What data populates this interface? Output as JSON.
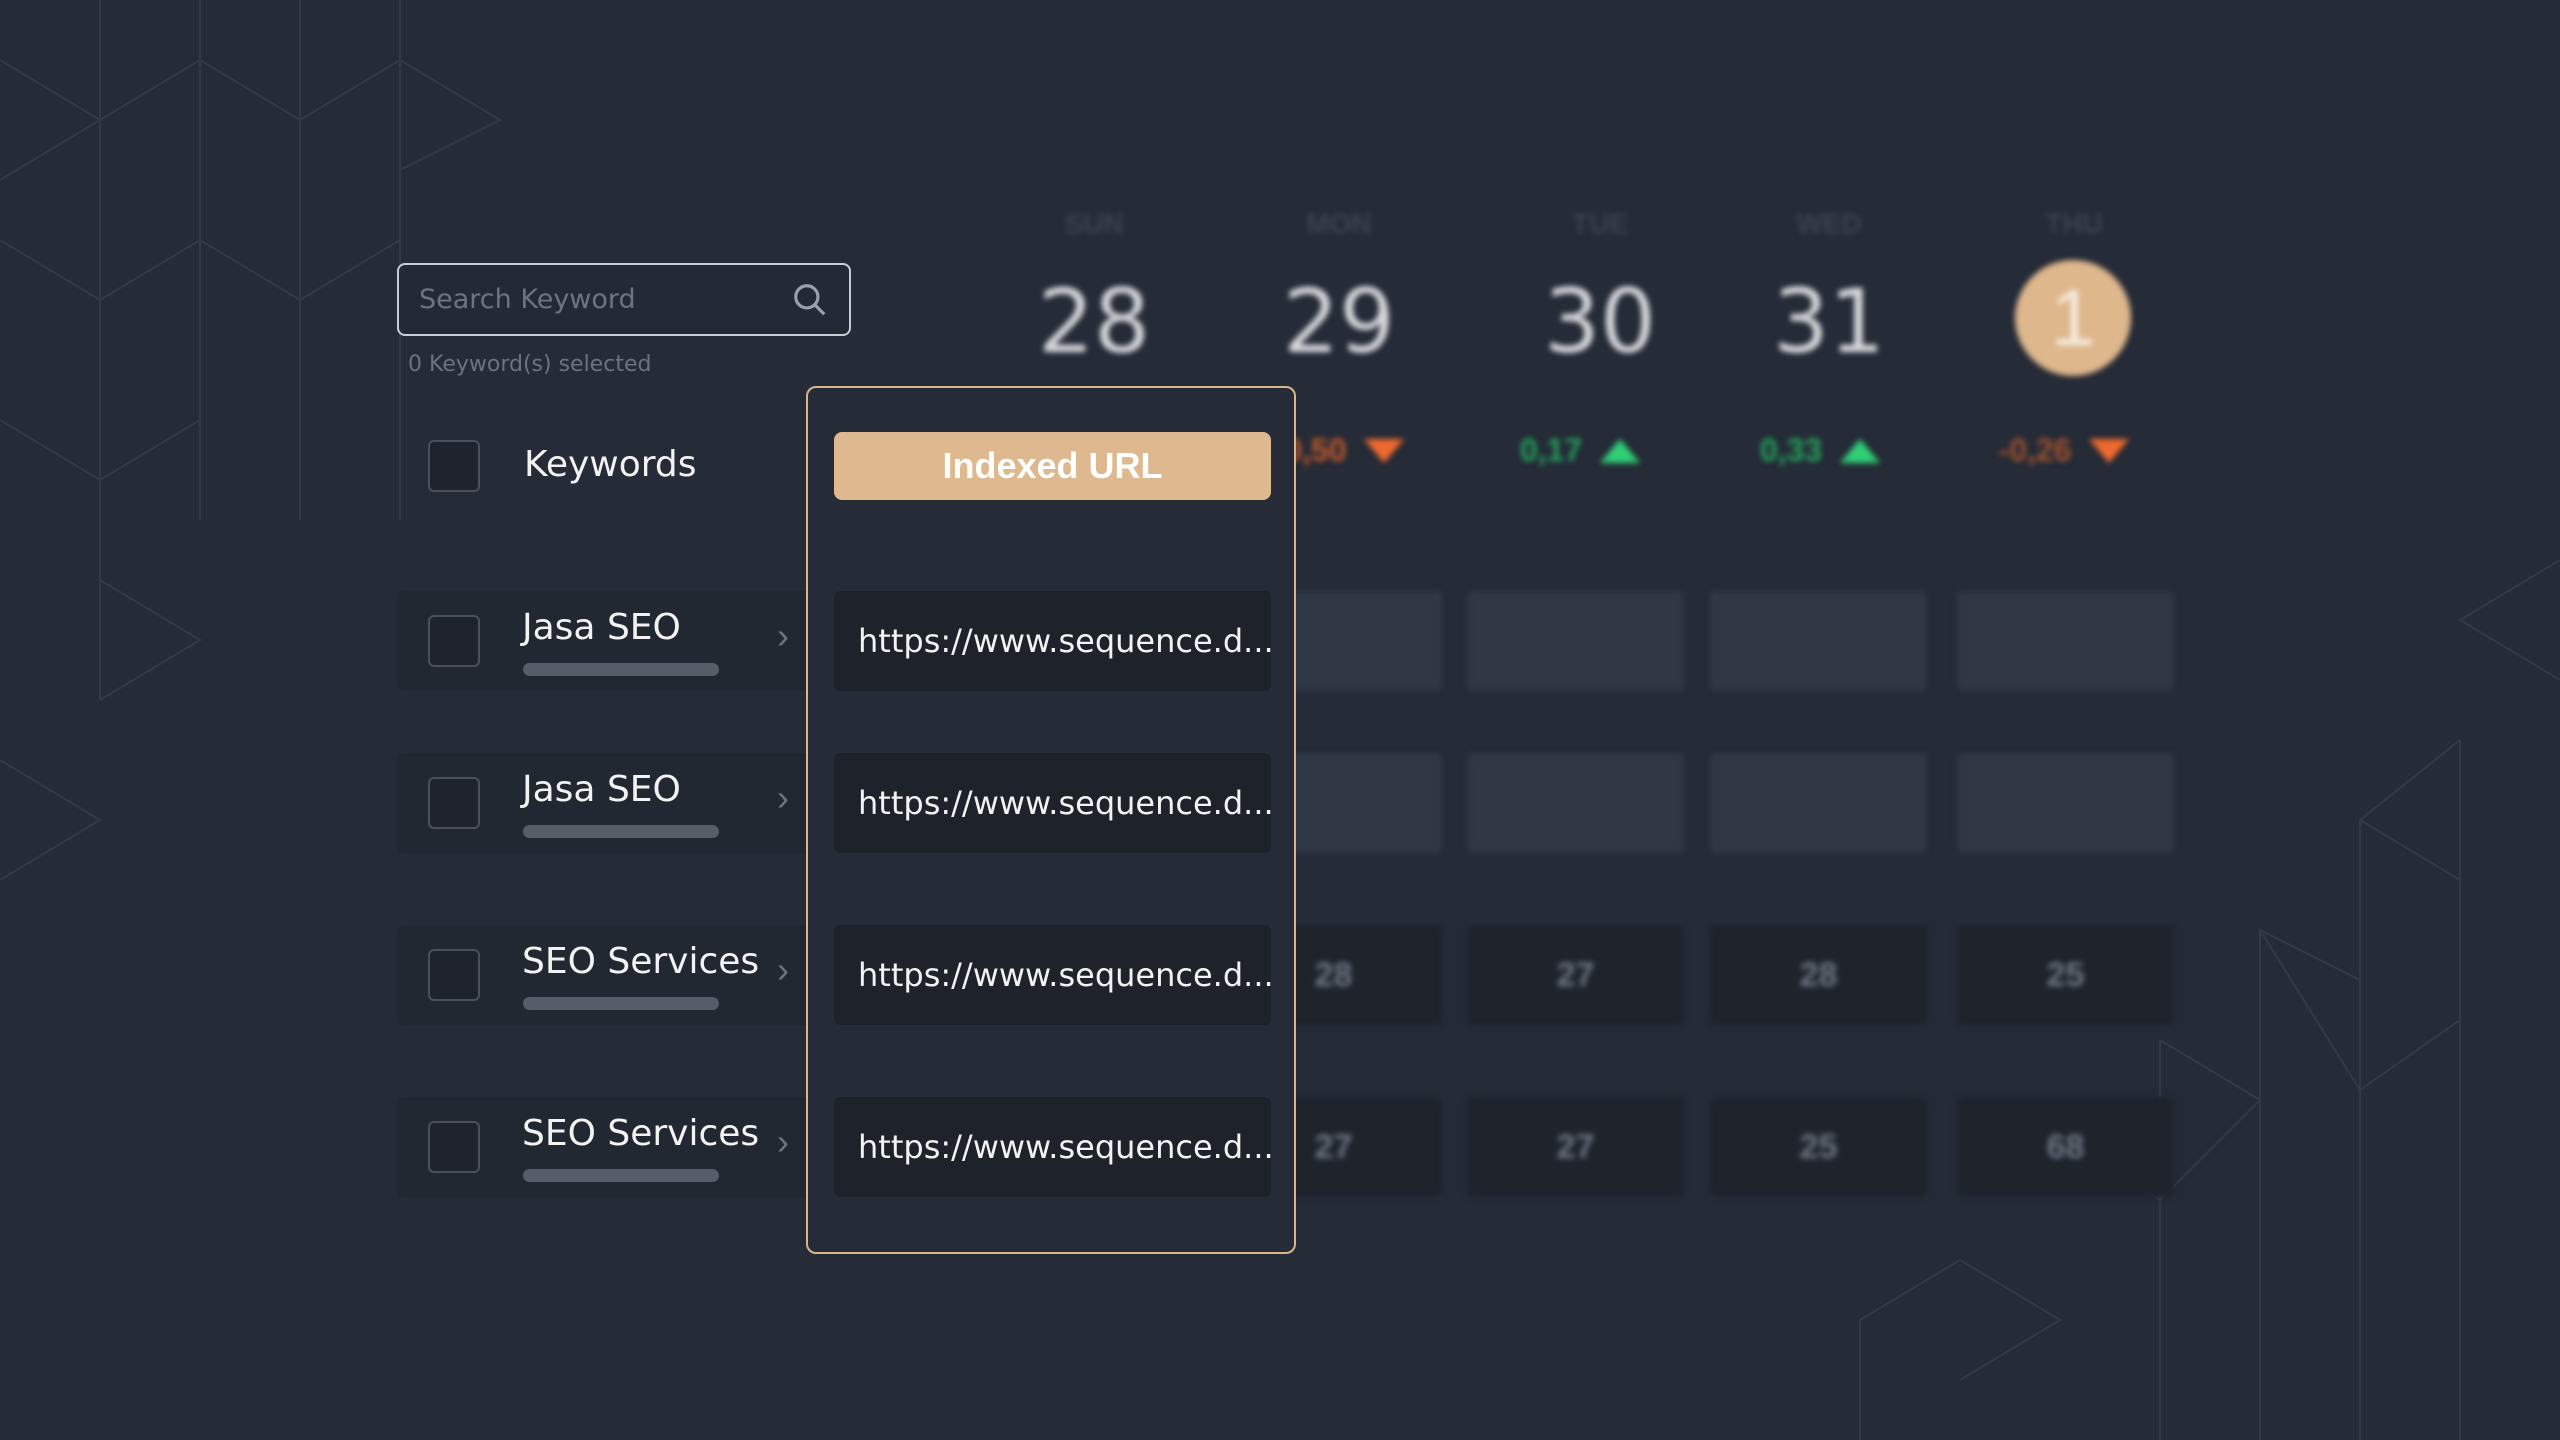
{
  "search": {
    "placeholder": "Search Keyword",
    "icon": "search-icon"
  },
  "selected_text": "0 Keyword(s) selected",
  "keywords_header": "Keywords",
  "indexed_url_header": "Indexed URL",
  "days": [
    {
      "label": "SUN",
      "num": "28",
      "delta": "",
      "trend": ""
    },
    {
      "label": "MON",
      "num": "29",
      "delta": "-0,50",
      "trend": "down"
    },
    {
      "label": "TUE",
      "num": "30",
      "delta": "0,17",
      "trend": "up"
    },
    {
      "label": "WED",
      "num": "31",
      "delta": "0,33",
      "trend": "up"
    },
    {
      "label": "THU",
      "num": "1",
      "delta": "-0,26",
      "trend": "down"
    }
  ],
  "rows": [
    {
      "keyword": "Jasa SEO",
      "url": "https://www.sequence.d...",
      "values": [
        "",
        "",
        "",
        ""
      ]
    },
    {
      "keyword": "Jasa SEO",
      "url": "https://www.sequence.d...",
      "values": [
        "",
        "",
        "",
        ""
      ]
    },
    {
      "keyword": "SEO Services",
      "url": "https://www.sequence.d...",
      "values": [
        "28",
        "27",
        "28",
        "25"
      ]
    },
    {
      "keyword": "SEO Services",
      "url": "https://www.sequence.d...",
      "values": [
        "27",
        "27",
        "25",
        "68"
      ]
    }
  ],
  "colors": {
    "accent": "#deb98f",
    "up": "#2fcf74",
    "down": "#ef6a2e",
    "background": "#252b37"
  }
}
